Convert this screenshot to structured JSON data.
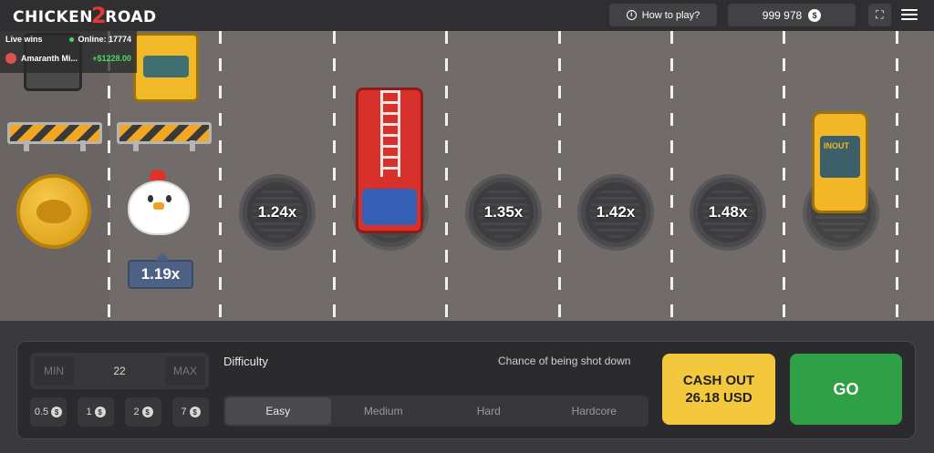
{
  "header": {
    "logo_part1": "CHICKEN",
    "logo_number": "2",
    "logo_part2": "ROAD",
    "how_to_play": "How to play?",
    "balance": "999 978",
    "currency_symbol": "$"
  },
  "live_wins": {
    "title": "Live wins",
    "online": "Online: 17774",
    "player": "Amaranth Mi...",
    "amount": "+$1228.00"
  },
  "road": {
    "current_multiplier": "1.19x",
    "multipliers": [
      "1.24x",
      "1.35x",
      "1.42x",
      "1.48x"
    ],
    "taxi_sign": "INOUT"
  },
  "controls": {
    "bet": {
      "min_label": "MIN",
      "value": "22",
      "max_label": "MAX"
    },
    "chips": [
      "0.5",
      "1",
      "2",
      "7"
    ],
    "chip_symbol": "$",
    "difficulty_label": "Difficulty",
    "chance_label": "Chance of being shot down",
    "difficulties": [
      "Easy",
      "Medium",
      "Hard",
      "Hardcore"
    ],
    "selected_difficulty": "Easy",
    "cashout_line1": "CASH OUT",
    "cashout_line2": "26.18 USD",
    "go_label": "GO"
  },
  "colors": {
    "accent_yellow": "#f3c83c",
    "go_green": "#2fa045",
    "road_gray": "#716c6a"
  }
}
